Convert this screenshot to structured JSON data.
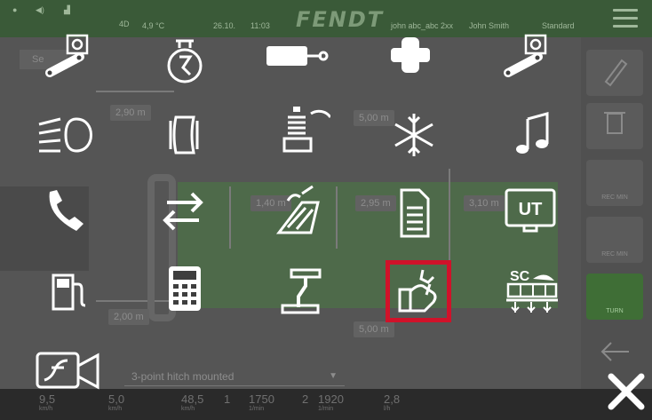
{
  "topbar": {
    "brand": "FENDT",
    "temp": "4,9 °C",
    "date": "26.10.",
    "time": "11:03",
    "item_a": "john abc_abc 2xx",
    "item_b": "John Smith",
    "item_c": "Standard",
    "small_4d": "4D"
  },
  "background": {
    "search_hint": "Se",
    "dim_top": "2,90 m",
    "dim_bottom": "2,00 m",
    "dim_a": "5,00 m",
    "dim_b": "1,40 m",
    "dim_c": "2,95 m",
    "dim_d": "3,10 m",
    "dim_e": "5,00 m",
    "dropdown": "3-point hitch mounted"
  },
  "sidepanel": {
    "rec_min_1": "REC MIN",
    "rec_min_2": "REC MIN",
    "turn": "TURN"
  },
  "bottombar": {
    "speed1": "9,5",
    "speed1_unit": "km/h",
    "speed2": "5,0",
    "speed2_unit": "km/h",
    "speed3": "48,5",
    "speed3_unit": "km/h",
    "rpm1_label": "1",
    "rpm1": "1750",
    "rpm1_unit": "1/min",
    "rpm2_label": "2",
    "rpm2": "1920",
    "rpm2_unit": "1/min",
    "fuel": "2,8",
    "fuel_unit": "l/h"
  },
  "icons": {
    "row1": [
      "link-settings-icon",
      "engine-settings-icon",
      "hydraulic-cylinder-icon",
      "joint-icon",
      "link-settings-2-icon"
    ],
    "row2": [
      "headlight-icon",
      "tire-icon",
      "suspension-icon",
      "air-conditioning-icon",
      "music-icon"
    ],
    "row3": [
      "phone-icon",
      "reverse-icon",
      "mower-icon",
      "document-icon",
      "ut-terminal-icon"
    ],
    "row4": [
      "fuel-icon",
      "calculator-icon",
      "hitch-icon",
      "service-icon",
      "section-control-icon"
    ],
    "row5": [
      "camera-icon"
    ]
  },
  "labels": {
    "ut": "UT",
    "sc": "SC"
  },
  "accent_color": "#d0122a"
}
